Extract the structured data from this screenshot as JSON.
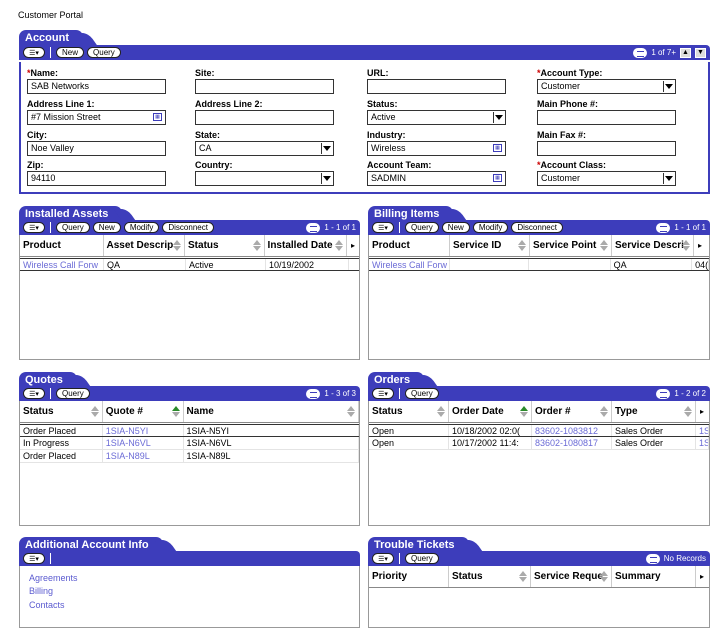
{
  "portal_title": "Customer Portal",
  "account": {
    "tab": "Account",
    "buttons": {
      "new": "New",
      "query": "Query"
    },
    "record_count": "1 of 7+",
    "fields": {
      "name": {
        "label": "Name:",
        "value": "SAB Networks",
        "required": "*"
      },
      "site": {
        "label": "Site:",
        "value": ""
      },
      "url": {
        "label": "URL:",
        "value": ""
      },
      "account_type": {
        "label": "Account Type:",
        "value": "Customer",
        "required": "*"
      },
      "address1": {
        "label": "Address Line 1:",
        "value": "#7 Mission Street"
      },
      "address2": {
        "label": "Address Line 2:",
        "value": ""
      },
      "status": {
        "label": "Status:",
        "value": "Active"
      },
      "main_phone": {
        "label": "Main Phone #:",
        "value": ""
      },
      "city": {
        "label": "City:",
        "value": "Noe Valley"
      },
      "state": {
        "label": "State:",
        "value": "CA"
      },
      "industry": {
        "label": "Industry:",
        "value": "Wireless"
      },
      "main_fax": {
        "label": "Main Fax #:",
        "value": ""
      },
      "zip": {
        "label": "Zip:",
        "value": "94110"
      },
      "country": {
        "label": "Country:",
        "value": ""
      },
      "account_team": {
        "label": "Account Team:",
        "value": "SADMIN"
      },
      "account_class": {
        "label": "Account Class:",
        "value": "Customer",
        "required": "*"
      }
    }
  },
  "installed_assets": {
    "tab": "Installed Assets",
    "buttons": {
      "query": "Query",
      "new": "New",
      "modify": "Modify",
      "disconnect": "Disconnect"
    },
    "record_count": "1 - 1 of 1",
    "columns": [
      "Product",
      "Asset Descrip",
      "Status",
      "Installed Date"
    ],
    "rows": [
      [
        "Wireless Call Forw",
        "QA",
        "Active",
        "10/19/2002"
      ]
    ]
  },
  "billing_items": {
    "tab": "Billing Items",
    "buttons": {
      "query": "Query",
      "new": "New",
      "modify": "Modify",
      "disconnect": "Disconnect"
    },
    "record_count": "1 - 1 of 1",
    "columns": [
      "Product",
      "Service ID",
      "Service Point",
      "Service Descri"
    ],
    "rows": [
      [
        "Wireless Call Forw",
        "",
        "",
        "QA",
        "04("
      ]
    ]
  },
  "quotes": {
    "tab": "Quotes",
    "buttons": {
      "query": "Query"
    },
    "record_count": "1 - 3 of 3",
    "columns": [
      "Status",
      "Quote #",
      "Name"
    ],
    "rows": [
      [
        "Order Placed",
        "1SIA-N5YI",
        "1SIA-N5YI"
      ],
      [
        "In Progress",
        "1SIA-N6VL",
        "1SIA-N6VL"
      ],
      [
        "Order Placed",
        "1SIA-N89L",
        "1SIA-N89L"
      ]
    ]
  },
  "orders": {
    "tab": "Orders",
    "buttons": {
      "query": "Query"
    },
    "record_count": "1 - 2 of 2",
    "columns": [
      "Status",
      "Order Date",
      "Order #",
      "Type"
    ],
    "rows": [
      [
        "Open",
        "10/18/2002 02:0(",
        "83602-1083812",
        "Sales Order",
        "1S."
      ],
      [
        "Open",
        "10/17/2002 11:4:",
        "83602-1080817",
        "Sales Order",
        "1S."
      ]
    ]
  },
  "additional_info": {
    "tab": "Additional Account Info",
    "links": [
      "Agreements",
      "Billing",
      "Contacts"
    ]
  },
  "trouble_tickets": {
    "tab": "Trouble Tickets",
    "buttons": {
      "query": "Query"
    },
    "record_count": "No Records",
    "columns": [
      "Priority",
      "Status",
      "Service Reque",
      "Summary"
    ]
  },
  "colors": {
    "accent": "#3d3dbb",
    "link": "#6b6bd6",
    "required": "#cc0000"
  }
}
